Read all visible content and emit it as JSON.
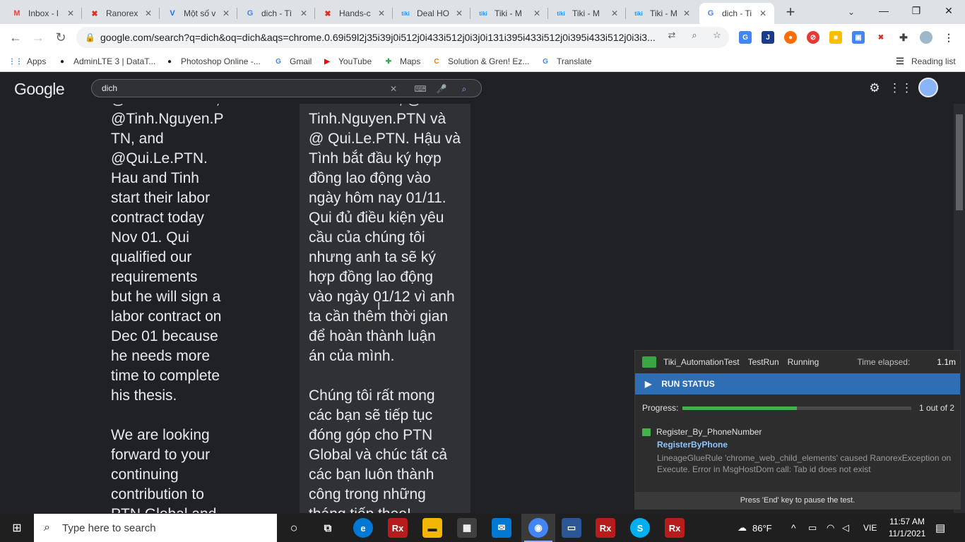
{
  "tabs": [
    {
      "icon": "gmail-icon",
      "glyph": "M",
      "color": "#ea4335",
      "title": "Inbox - l"
    },
    {
      "icon": "ranorex-icon",
      "glyph": "✖",
      "color": "#d93025",
      "title": "Ranorex"
    },
    {
      "icon": "v-icon",
      "glyph": "V",
      "color": "#1a73e8",
      "title": "Một số v"
    },
    {
      "icon": "google-icon",
      "glyph": "G",
      "color": "#4285f4",
      "title": "dich - Tì"
    },
    {
      "icon": "ranorex-icon",
      "glyph": "✖",
      "color": "#d93025",
      "title": "Hands-c"
    },
    {
      "icon": "tiki-icon",
      "glyph": "tiki",
      "color": "#1a94ff",
      "title": "Deal HO"
    },
    {
      "icon": "tiki-icon",
      "glyph": "tiki",
      "color": "#1a94ff",
      "title": "Tiki - M"
    },
    {
      "icon": "tiki-icon",
      "glyph": "tiki",
      "color": "#1a94ff",
      "title": "Tiki - M"
    },
    {
      "icon": "tiki-icon",
      "glyph": "tiki",
      "color": "#1a94ff",
      "title": "Tiki - M"
    },
    {
      "icon": "google-icon",
      "glyph": "G",
      "color": "#4285f4",
      "title": "dich - Ti"
    }
  ],
  "address": {
    "url": "google.com/search?q=dich&oq=dich&aqs=chrome.0.69i59l2j35i39j0i512j0i433i512j0i3j0i131i395i433i512j0i395i433i512j0i3i3..."
  },
  "bookmarks": [
    {
      "icon": "apps-icon",
      "glyph": "⋮⋮",
      "color": "#1a73e8",
      "label": "Apps"
    },
    {
      "icon": "adminlte-icon",
      "glyph": "●",
      "color": "#202124",
      "label": "AdminLTE 3 | DataT..."
    },
    {
      "icon": "photoshop-icon",
      "glyph": "●",
      "color": "#202124",
      "label": "Photoshop Online -..."
    },
    {
      "icon": "google-icon",
      "glyph": "G",
      "color": "#4285f4",
      "label": "Gmail"
    },
    {
      "icon": "youtube-icon",
      "glyph": "▶",
      "color": "#ff0000",
      "label": "YouTube"
    },
    {
      "icon": "maps-icon",
      "glyph": "✚",
      "color": "#34a853",
      "label": "Maps"
    },
    {
      "icon": "solution-icon",
      "glyph": "C",
      "color": "#f57c00",
      "label": "Solution & Gren! Ez..."
    },
    {
      "icon": "translate-icon",
      "glyph": "G",
      "color": "#4285f4",
      "label": "Translate"
    }
  ],
  "reading_list": "Reading list",
  "google": {
    "logo": "Google",
    "query": "dich"
  },
  "translation": {
    "source": "@Hau.Lau.PTN,\n@Tinh.Nguyen.P\nTN, and\n@Qui.Le.PTN.\nHau and Tinh\nstart their labor\ncontract today\nNov 01. Qui\nqualified our\nrequirements\nbut he will sign a\nlabor contract on\nDec 01 because\nhe needs more\ntime to complete\nhis thesis.\n\nWe are looking\nforward to your\ncontinuing\ncontribution to\nPTN Global and",
    "target": "Hau.Lau.PTN, @\nTinh.Nguyen.PTN và\n@ Qui.Le.PTN. Hậu và\nTình bắt đầu ký hợp\nđồng lao động vào\nngày hôm nay 01/11.\nQui đủ điều kiện yêu\ncầu của chúng tôi\nnhưng anh ta sẽ ký\nhợp đồng lao động\nvào ngày 01/12 vì anh\nta cần thêm thời gian\nđể hoàn thành luận\nán của mình.\n\nChúng tôi rất mong\ncác bạn sẽ tiếp tục\nđóng góp cho PTN\nGlobal và chúc tất cả\ncác bạn luôn thành\ncông trong những\ntháng tiếp theo!"
  },
  "ranorex": {
    "project": "Tiki_AutomationTest",
    "run": "TestRun",
    "state": "Running",
    "elapsed_label": "Time elapsed:",
    "elapsed_value": "1.1m",
    "run_status": "RUN STATUS",
    "progress_label": "Progress:",
    "progress_fraction": 0.5,
    "progress_count": "1 out of 2",
    "testcase": "Register_By_PhoneNumber",
    "module": "RegisterByPhone",
    "error": "LineageGlueRule 'chrome_web_child_elements' caused RanorexException on Execute. Error in MsgHostDom call: Tab id does not exist",
    "footer": "Press 'End' key to pause the test."
  },
  "taskbar": {
    "search_placeholder": "Type here to search",
    "weather": "86°F",
    "lang": "VIE",
    "time": "11:57 AM",
    "date": "11/1/2021"
  }
}
